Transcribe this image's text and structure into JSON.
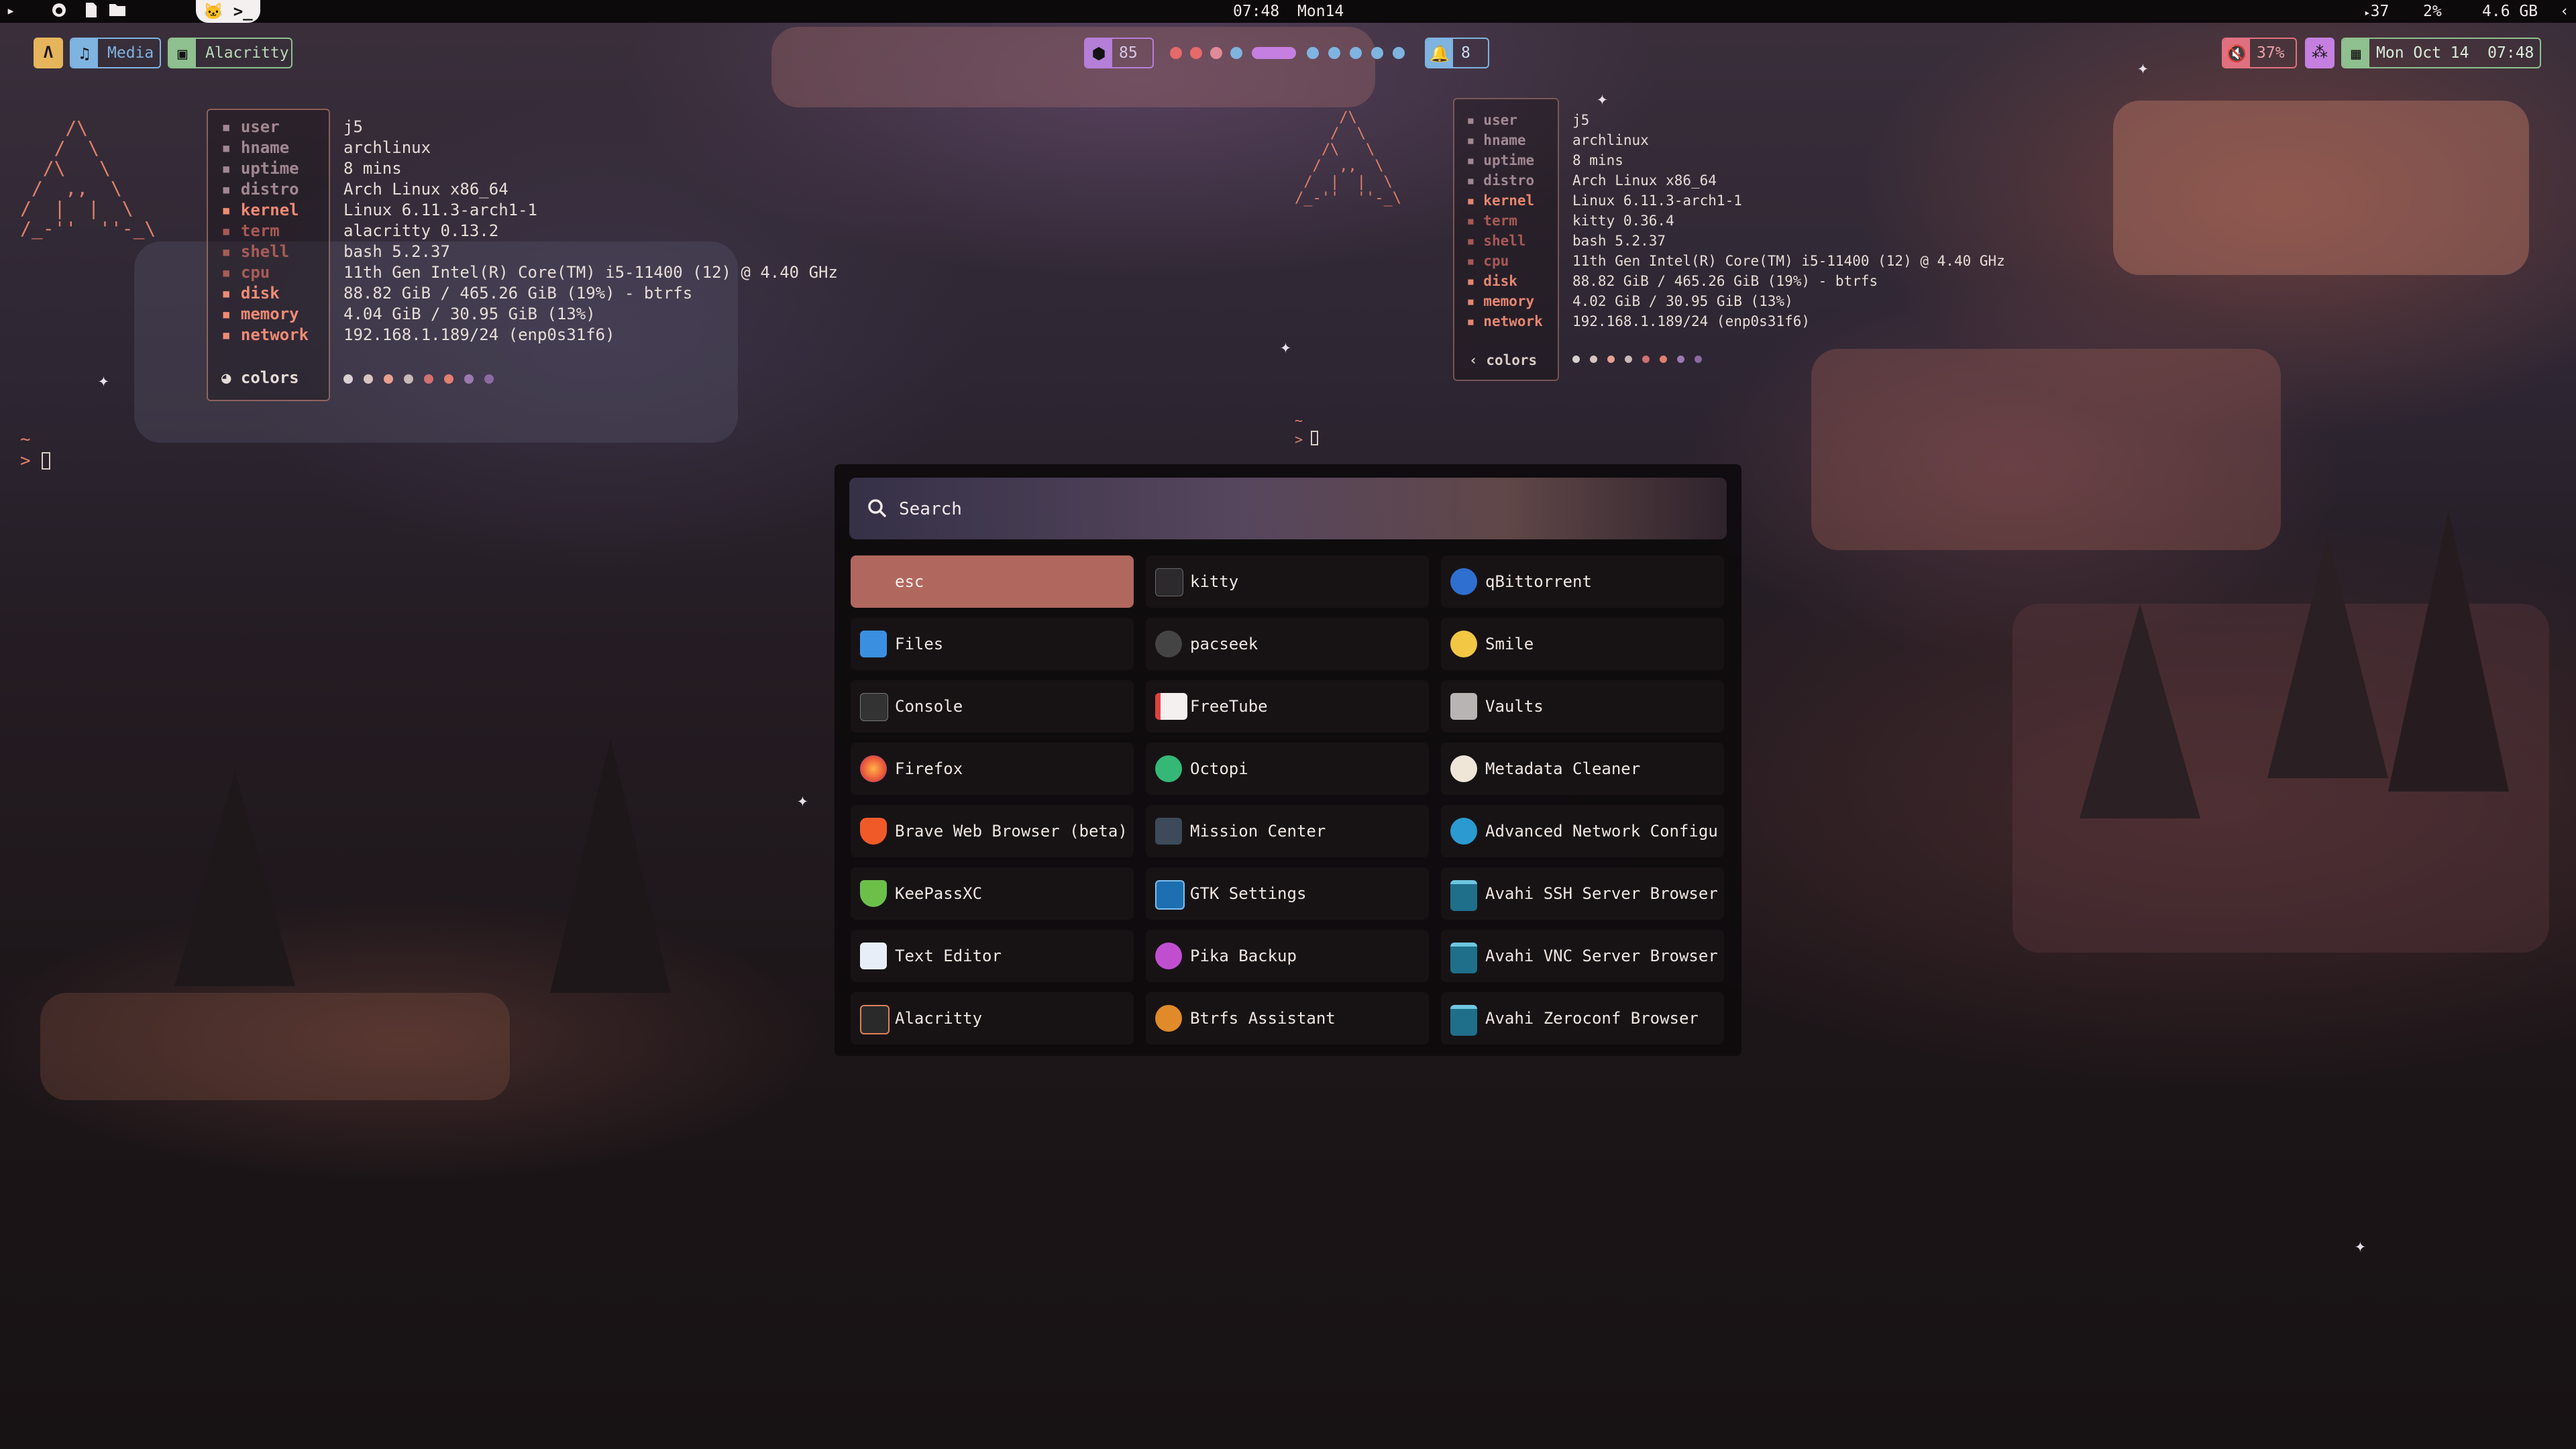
{
  "topbar": {
    "clock": "07:48",
    "day": "Mon14",
    "updates": "37",
    "cpu": "2%",
    "memory": "4.6 GB"
  },
  "waybar": {
    "arch_icon": "arch-logo",
    "media_label": "Media",
    "window_label": "Alacritty",
    "ws_count": "85",
    "notif_count": "8",
    "volume": "37%",
    "clock": "Mon Oct 14  07:48"
  },
  "fastfetch_left": {
    "labels": [
      "user",
      "hname",
      "uptime",
      "distro",
      "kernel",
      "term",
      "shell",
      "cpu",
      "disk",
      "memory",
      "network"
    ],
    "values": [
      "j5",
      "archlinux",
      "8 mins",
      "Arch Linux x86_64",
      "Linux 6.11.3-arch1-1",
      "alacritty 0.13.2",
      "bash 5.2.37",
      "11th Gen Intel(R) Core(TM) i5-11400 (12) @ 4.40 GHz",
      "88.82 GiB / 465.26 GiB (19%) - btrfs",
      "4.04 GiB / 30.95 GiB (13%)",
      "192.168.1.189/24 (enp0s31f6)"
    ],
    "colors_label": "colors"
  },
  "fastfetch_right": {
    "labels": [
      "user",
      "hname",
      "uptime",
      "distro",
      "kernel",
      "term",
      "shell",
      "cpu",
      "disk",
      "memory",
      "network"
    ],
    "values": [
      "j5",
      "archlinux",
      "8 mins",
      "Arch Linux x86_64",
      "Linux 6.11.3-arch1-1",
      "kitty 0.36.4",
      "bash 5.2.37",
      "11th Gen Intel(R) Core(TM) i5-11400 (12) @ 4.40 GHz",
      "88.82 GiB / 465.26 GiB (19%) - btrfs",
      "4.02 GiB / 30.95 GiB (13%)",
      "192.168.1.189/24 (enp0s31f6)"
    ],
    "colors_label": "colors"
  },
  "prompt": {
    "tilde": "~",
    "arrow": ">"
  },
  "launcher": {
    "search_placeholder": "Search",
    "apps": [
      {
        "label": "esc",
        "icon": "esc"
      },
      {
        "label": "kitty",
        "icon": "terminal-icon"
      },
      {
        "label": "qBittorrent",
        "icon": "qbittorrent-icon"
      },
      {
        "label": "Files",
        "icon": "folder-icon"
      },
      {
        "label": "pacseek",
        "icon": "pacseek-icon"
      },
      {
        "label": "Smile",
        "icon": "emoji-icon"
      },
      {
        "label": "Console",
        "icon": "console-icon"
      },
      {
        "label": "FreeTube",
        "icon": "freetube-icon"
      },
      {
        "label": "Vaults",
        "icon": "vaults-icon"
      },
      {
        "label": "Firefox",
        "icon": "firefox-icon"
      },
      {
        "label": "Octopi",
        "icon": "octopi-icon"
      },
      {
        "label": "Metadata Cleaner",
        "icon": "metadata-icon"
      },
      {
        "label": "Brave Web Browser (beta)",
        "icon": "brave-icon"
      },
      {
        "label": "Mission Center",
        "icon": "mission-center-icon"
      },
      {
        "label": "Advanced Network Configu…",
        "icon": "network-gear-icon"
      },
      {
        "label": "KeePassXC",
        "icon": "keepass-icon"
      },
      {
        "label": "GTK Settings",
        "icon": "gtk-settings-icon"
      },
      {
        "label": "Avahi SSH Server Browser",
        "icon": "avahi-icon"
      },
      {
        "label": "Text Editor",
        "icon": "text-editor-icon"
      },
      {
        "label": "Pika Backup",
        "icon": "pika-backup-icon"
      },
      {
        "label": "Avahi VNC Server Browser",
        "icon": "avahi-icon"
      },
      {
        "label": "Alacritty",
        "icon": "alacritty-icon"
      },
      {
        "label": "Btrfs Assistant",
        "icon": "btrfs-icon"
      },
      {
        "label": "Avahi Zeroconf Browser",
        "icon": "avahi-icon"
      }
    ]
  },
  "colors": {
    "accent": "#b0675e",
    "label_left": "#e58670",
    "media": "#7fb3e0",
    "window": "#8fc08f"
  }
}
